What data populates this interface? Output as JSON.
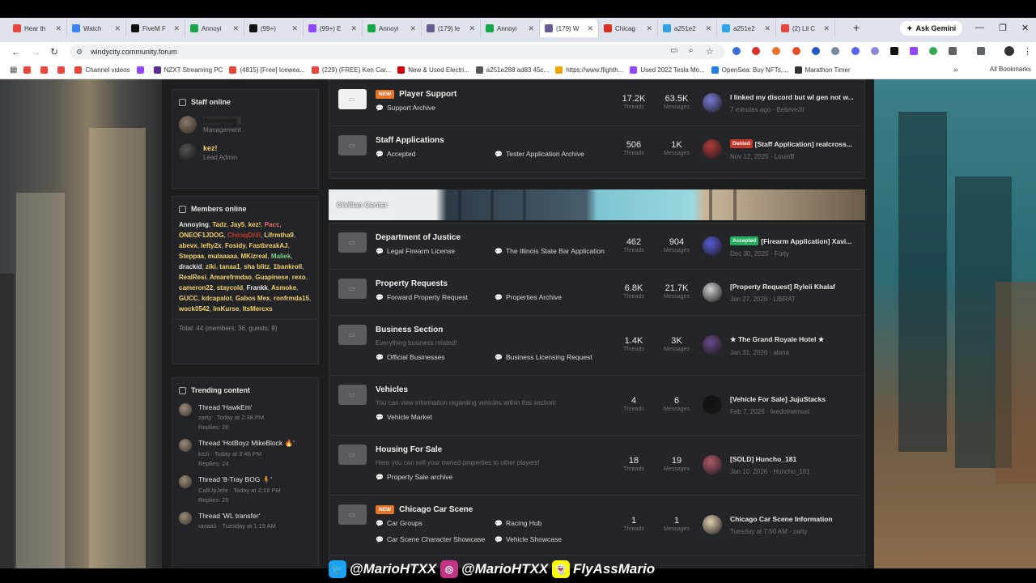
{
  "browser": {
    "tabs": [
      {
        "label": "Hear th",
        "color": "#e8453c",
        "active": false
      },
      {
        "label": "Watch",
        "color": "#3b82f6",
        "active": false
      },
      {
        "label": "FiveM F",
        "color": "#111111",
        "active": false
      },
      {
        "label": "Annoyi",
        "color": "#1aa64b",
        "active": false
      },
      {
        "label": "(99+)",
        "color": "#111111",
        "active": false
      },
      {
        "label": "(99+) E",
        "color": "#9146ff",
        "active": false
      },
      {
        "label": "Annoyi",
        "color": "#1aa64b",
        "active": false
      },
      {
        "label": "(179) le",
        "color": "#6b5b95",
        "active": false
      },
      {
        "label": "Annoyi",
        "color": "#1aa64b",
        "active": false
      },
      {
        "label": "(179) W",
        "color": "#6b5b95",
        "active": true
      },
      {
        "label": "Chicag",
        "color": "#d93025",
        "active": false
      },
      {
        "label": "a251e2",
        "color": "#2fa4e7",
        "active": false
      },
      {
        "label": "a251e2",
        "color": "#2fa4e7",
        "active": false
      },
      {
        "label": "(2) Lil C",
        "color": "#e8453c",
        "active": false
      }
    ],
    "new_tab": "+",
    "ask_gemini": "Ask Gemini",
    "url": "windycity.community.forum",
    "bookmarks": [
      {
        "label": "",
        "color": "#e8453c"
      },
      {
        "label": "",
        "color": "#e8453c"
      },
      {
        "label": "",
        "color": "#e8453c"
      },
      {
        "label": "Channel videos",
        "color": "#e8453c"
      },
      {
        "label": "",
        "color": "#9146ff"
      },
      {
        "label": "NZXT Streaming PC",
        "color": "#5a2d91"
      },
      {
        "label": "(4815) [Free] Icewea...",
        "color": "#e8453c"
      },
      {
        "label": "(229) (FREE) Ken Car...",
        "color": "#e8453c"
      },
      {
        "label": "New & Used Electri...",
        "color": "#cc0000"
      },
      {
        "label": "a251e288 ad83 45c...",
        "color": "#555555"
      },
      {
        "label": "https://www.flighth...",
        "color": "#f0a500"
      },
      {
        "label": "Used 2022 Tesla Mo...",
        "color": "#9146ff"
      },
      {
        "label": "OpenSea: Buy NFTs,...",
        "color": "#2081e2"
      },
      {
        "label": "Marathon Timer",
        "color": "#333333"
      }
    ],
    "all_bookmarks": "All Bookmarks"
  },
  "sidebar": {
    "staff_title": "Staff online",
    "staff": [
      {
        "name": "Annoying",
        "role": "Management"
      },
      {
        "name": "kez!",
        "role": "Lead Admin"
      }
    ],
    "members_title": "Members online",
    "members": [
      {
        "name": "Annoying",
        "color": "#e8e8e8"
      },
      {
        "name": "Tadz",
        "color": "#f2d26b"
      },
      {
        "name": "Jay5",
        "color": "#f2d26b"
      },
      {
        "name": "kez!",
        "color": "#f2d26b"
      },
      {
        "name": "Pacc",
        "color": "#e8746b"
      },
      {
        "name": "ONEOF1JDOG",
        "color": "#f2d26b"
      },
      {
        "name": "ChiraqDrill",
        "color": "#c0392b"
      },
      {
        "name": "Lifrmtha9",
        "color": "#f2d26b"
      },
      {
        "name": "abevx",
        "color": "#f2d26b"
      },
      {
        "name": "lefty2x",
        "color": "#f2d26b"
      },
      {
        "name": "Fosidy",
        "color": "#f2d26b"
      },
      {
        "name": "FastbreakAJ",
        "color": "#f2d26b"
      },
      {
        "name": "Steppaa",
        "color": "#f2d26b"
      },
      {
        "name": "mulaaaaa",
        "color": "#f2d26b"
      },
      {
        "name": "MKizreal",
        "color": "#f2d26b"
      },
      {
        "name": "Maliek",
        "color": "#7ed37e"
      },
      {
        "name": "drackid",
        "color": "#e8e8e8"
      },
      {
        "name": "ziki",
        "color": "#f2d26b"
      },
      {
        "name": "tanaa1",
        "color": "#f2d26b"
      },
      {
        "name": "sha blitz",
        "color": "#f2d26b"
      },
      {
        "name": "1bankroll",
        "color": "#f2d26b"
      },
      {
        "name": "RealResi",
        "color": "#f2d26b"
      },
      {
        "name": "Amarefrmdao",
        "color": "#f2d26b"
      },
      {
        "name": "Guapinese",
        "color": "#f2d26b"
      },
      {
        "name": "rexo",
        "color": "#f2d26b"
      },
      {
        "name": "cameron22",
        "color": "#f2d26b"
      },
      {
        "name": "staycold",
        "color": "#f2d26b"
      },
      {
        "name": "Frankk",
        "color": "#e8e8e8"
      },
      {
        "name": "Asmoke",
        "color": "#f2d26b"
      },
      {
        "name": "GUCC",
        "color": "#f2d26b"
      },
      {
        "name": "kdcapalot",
        "color": "#f2d26b"
      },
      {
        "name": "Gabos Mex",
        "color": "#f2d26b"
      },
      {
        "name": "ronfrmda15",
        "color": "#f2d26b"
      },
      {
        "name": "wock0542",
        "color": "#f2d26b"
      },
      {
        "name": "ImKurse",
        "color": "#f2d26b"
      },
      {
        "name": "ItsMercxs",
        "color": "#f2d26b"
      }
    ],
    "members_total": "Total: 44 (members: 36, guests: 8)",
    "trending_title": "Trending content",
    "trending": [
      {
        "title": "Thread 'HawkEm'",
        "meta": "zarty · Today at 2:38 PM",
        "replies": "Replies: 26"
      },
      {
        "title": "Thread 'HotBoyz MikeBlock 🔥'",
        "meta": "kezi · Today at 3:46 PM",
        "replies": "Replies: 24"
      },
      {
        "title": "Thread '8-Tray BOG 🧍'",
        "meta": "CallUpJefe · Today at 2:19 PM",
        "replies": "Replies: 25"
      },
      {
        "title": "Thread 'WL transfer'",
        "meta": "tanaa1 · Tuesday at 1:19 AM",
        "replies": ""
      }
    ]
  },
  "forums_top": [
    {
      "title": "Player Support",
      "new": true,
      "icon_white": true,
      "desc": "",
      "subs": [
        {
          "label": "Support Archive"
        }
      ],
      "threads": "17.2K",
      "messages": "63.5K",
      "last_title": "I linked my discord but wl gen not w...",
      "last_tag": "",
      "last_meta": "7 minutes ago · BelieveJit"
    },
    {
      "title": "Staff Applications",
      "new": false,
      "icon_white": false,
      "desc": "",
      "subs": [
        {
          "label": "Accepted"
        },
        {
          "label": "Tester Application Archive"
        }
      ],
      "threads": "506",
      "messages": "1K",
      "last_title": "[Staff Application] realcross...",
      "last_tag": "Denied",
      "last_meta": "Nov 12, 2025 · LouieB"
    }
  ],
  "category_banner": "Civilian Center",
  "forums_bottom": [
    {
      "title": "Department of Justice",
      "new": false,
      "desc": "",
      "subs": [
        {
          "label": "Legal Firearm License"
        },
        {
          "label": "The Illinois State Bar Application"
        }
      ],
      "threads": "462",
      "messages": "904",
      "last_title": "[Firearm Application] Xavi...",
      "last_tag": "Accepted",
      "last_meta": "Dec 30, 2025 · Forty"
    },
    {
      "title": "Property Requests",
      "new": false,
      "desc": "",
      "subs": [
        {
          "label": "Forward Property Request"
        },
        {
          "label": "Properties Archive"
        }
      ],
      "threads": "6.8K",
      "messages": "21.7K",
      "last_title": "[Property Request] Ryleii Khalaf",
      "last_tag": "",
      "last_meta": "Jan 27, 2026 · LIBRAT"
    },
    {
      "title": "Business Section",
      "new": false,
      "desc": "Everything business related!",
      "subs": [
        {
          "label": "Official Businesses"
        },
        {
          "label": "Business Licensing Request"
        }
      ],
      "threads": "1.4K",
      "messages": "3K",
      "last_title": "★ The Grand Royale Hotel ★",
      "last_tag": "",
      "last_meta": "Jan 31, 2026 · alana"
    },
    {
      "title": "Vehicles",
      "new": false,
      "desc": "You can view information regarding vehicles within this section!",
      "subs": [
        {
          "label": "Vehicle Market"
        }
      ],
      "threads": "4",
      "messages": "6",
      "last_title": "[Vehicle For Sale] JujuStacks",
      "last_tag": "",
      "last_meta": "Feb 7, 2026 · feedothemost"
    },
    {
      "title": "Housing For Sale",
      "new": false,
      "desc": "Here you can sell your owned properties to other players!",
      "subs": [
        {
          "label": "Property Sale archive"
        }
      ],
      "threads": "18",
      "messages": "19",
      "last_title": "[SOLD] Huncho_181",
      "last_tag": "",
      "last_meta": "Jan 10, 2026 · Huncho_181"
    },
    {
      "title": "Chicago Car Scene",
      "new": true,
      "desc": "",
      "subs": [
        {
          "label": "Car Groups"
        },
        {
          "label": "Racing Hub"
        },
        {
          "label": "Car Scene Character Showcase"
        },
        {
          "label": "Vehicle Showcase"
        }
      ],
      "threads": "1",
      "messages": "1",
      "last_title": "Chicago Car Scene Information",
      "last_tag": "",
      "last_meta": "Tuesday at 7:50 AM · zarty"
    }
  ],
  "labels": {
    "threads": "Threads",
    "messages": "Messages",
    "new": "NEW"
  },
  "overlay": [
    {
      "icon": "twitter-icon",
      "handle": "@MarioHTXX",
      "color": "#1da1f2"
    },
    {
      "icon": "instagram-icon",
      "handle": "@MarioHTXX",
      "color": "#c13584"
    },
    {
      "icon": "snapchat-icon",
      "handle": "FlyAssMario",
      "color": "#fffc00"
    }
  ]
}
